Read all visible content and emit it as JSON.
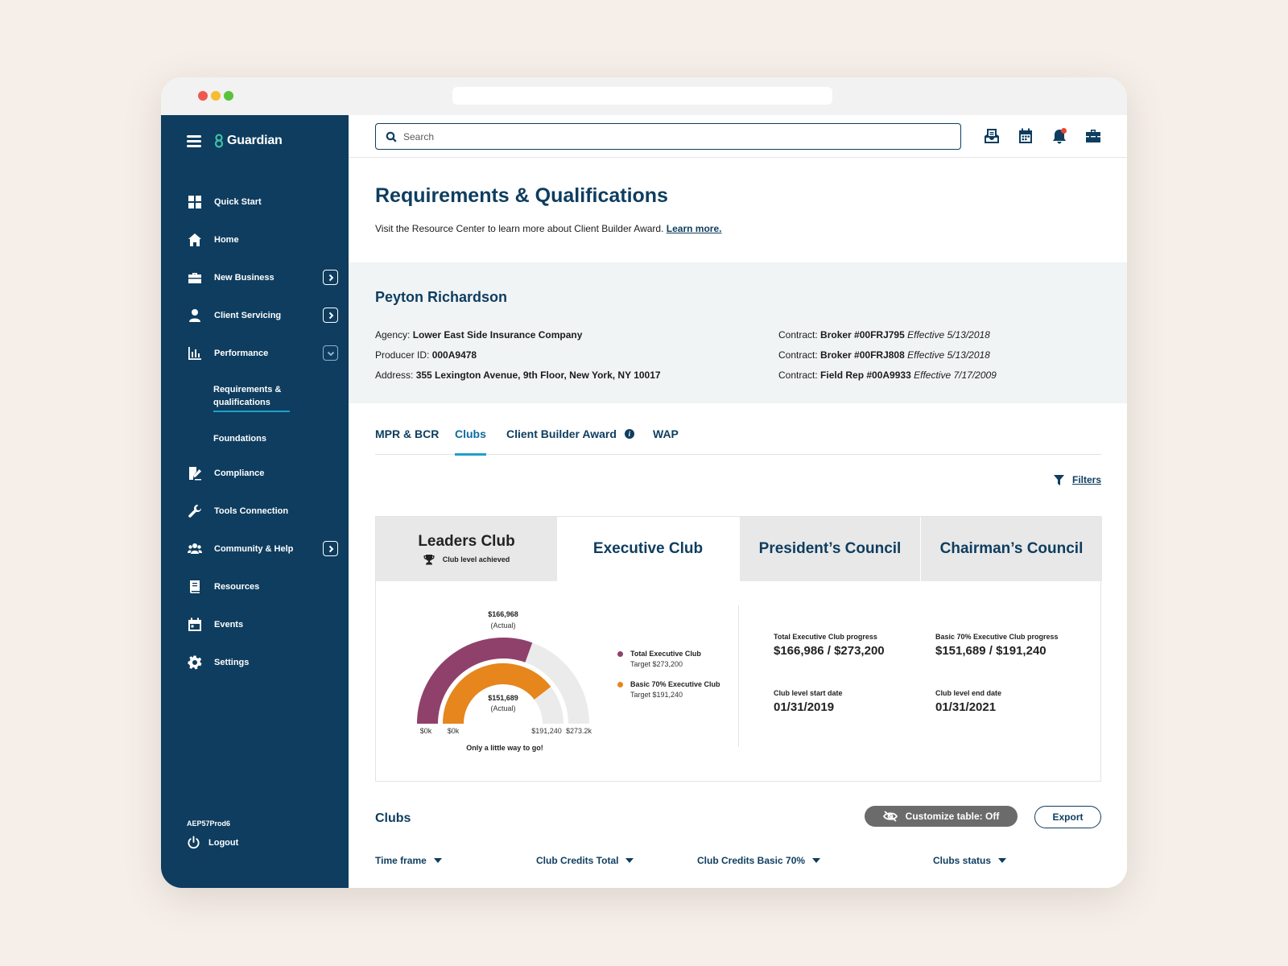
{
  "brand": {
    "name": "Guardian"
  },
  "sidebar": {
    "items": [
      {
        "label": "Quick Start",
        "icon": "grid-icon"
      },
      {
        "label": "Home",
        "icon": "home-icon"
      },
      {
        "label": "New Business",
        "icon": "briefcase-icon",
        "expand": "chevron-right-icon"
      },
      {
        "label": "Client Servicing",
        "icon": "user-icon",
        "expand": "chevron-right-icon"
      },
      {
        "label": "Performance",
        "icon": "bar-chart-icon",
        "expand": "chevron-down-icon"
      }
    ],
    "sub_items": [
      {
        "label": "Requirements & qualifications",
        "active": true
      },
      {
        "label": "Foundations"
      }
    ],
    "items_after": [
      {
        "label": "Compliance",
        "icon": "document-pen-icon"
      },
      {
        "label": "Tools Connection",
        "icon": "wrench-icon"
      },
      {
        "label": "Community & Help",
        "icon": "people-icon",
        "expand": "chevron-right-icon"
      },
      {
        "label": "Resources",
        "icon": "book-icon"
      },
      {
        "label": "Events",
        "icon": "calendar-icon"
      },
      {
        "label": "Settings",
        "icon": "gear-icon"
      }
    ],
    "environment": "AEP57Prod6",
    "logout_label": "Logout"
  },
  "topbar": {
    "search_placeholder": "Search",
    "icons": [
      "inbox-icon",
      "calendar-icon",
      "bell-icon",
      "toolbox-icon"
    ]
  },
  "page": {
    "title": "Requirements & Qualifications",
    "intro_text": "Visit the Resource Center to learn more about Client Builder Award.",
    "intro_link": "Learn more."
  },
  "profile": {
    "name": "Peyton Richardson",
    "agency_label": "Agency:",
    "agency_value": "Lower East Side Insurance Company",
    "producer_label": "Producer ID:",
    "producer_value": "000A9478",
    "address_label": "Address:",
    "address_value": "355 Lexington Avenue, 9th Floor, New York, NY 10017",
    "contracts": [
      {
        "label": "Contract:",
        "value": "Broker #00FRJ795",
        "effective": "Effective 5/13/2018"
      },
      {
        "label": "Contract:",
        "value": "Broker #00FRJ808",
        "effective": "Effective 5/13/2018"
      },
      {
        "label": "Contract:",
        "value": "Field Rep #00A9933",
        "effective": "Effective 7/17/2009"
      }
    ]
  },
  "tabs": [
    {
      "label": "MPR & BCR"
    },
    {
      "label": "Clubs",
      "active": true
    },
    {
      "label": "Client Builder Award",
      "info": "i"
    },
    {
      "label": "WAP"
    }
  ],
  "filters_label": "Filters",
  "club_tabs": [
    {
      "label": "Leaders Club",
      "sub": "Club level achieved",
      "state": "achieved"
    },
    {
      "label": "Executive Club",
      "state": "selected"
    },
    {
      "label": "President’s Council"
    },
    {
      "label": "Chairman’s Council"
    }
  ],
  "gauge": {
    "outer": {
      "actual_label": "$166,968",
      "actual_note": "(Actual)",
      "min_label": "$0k",
      "max_label": "$273.2k",
      "fraction": 0.61,
      "color": "#8f416b"
    },
    "inner": {
      "actual_label": "$151,689",
      "actual_note": "(Actual)",
      "min_label": "$0k",
      "max_label": "$191,240",
      "fraction": 0.79,
      "color": "#e6861d"
    },
    "track_color": "#ebebeb",
    "caption": "Only a little way to go!"
  },
  "legend": [
    {
      "name": "Total Executive Club",
      "target": "Target $273,200",
      "color": "#8f416b"
    },
    {
      "name": "Basic 70% Executive Club",
      "target": "Target $191,240",
      "color": "#e6861d"
    }
  ],
  "stats": [
    {
      "label": "Total Executive Club progress",
      "value": "$166,986 / $273,200"
    },
    {
      "label": "Basic 70% Executive Club progress",
      "value": "$151,689 / $191,240"
    },
    {
      "label": "Club level start date",
      "value": "01/31/2019"
    },
    {
      "label": "Club level end date",
      "value": "01/31/2021"
    }
  ],
  "clubs_table": {
    "title": "Clubs",
    "customize_label": "Customize table: Off",
    "export_label": "Export",
    "columns": [
      "Time frame",
      "Club Credits Total",
      "Club Credits Basic 70%",
      "Clubs status"
    ]
  },
  "colors": {
    "navy": "#0e3d5f",
    "accent": "#1fa0c8",
    "background": "#f6efe9"
  }
}
